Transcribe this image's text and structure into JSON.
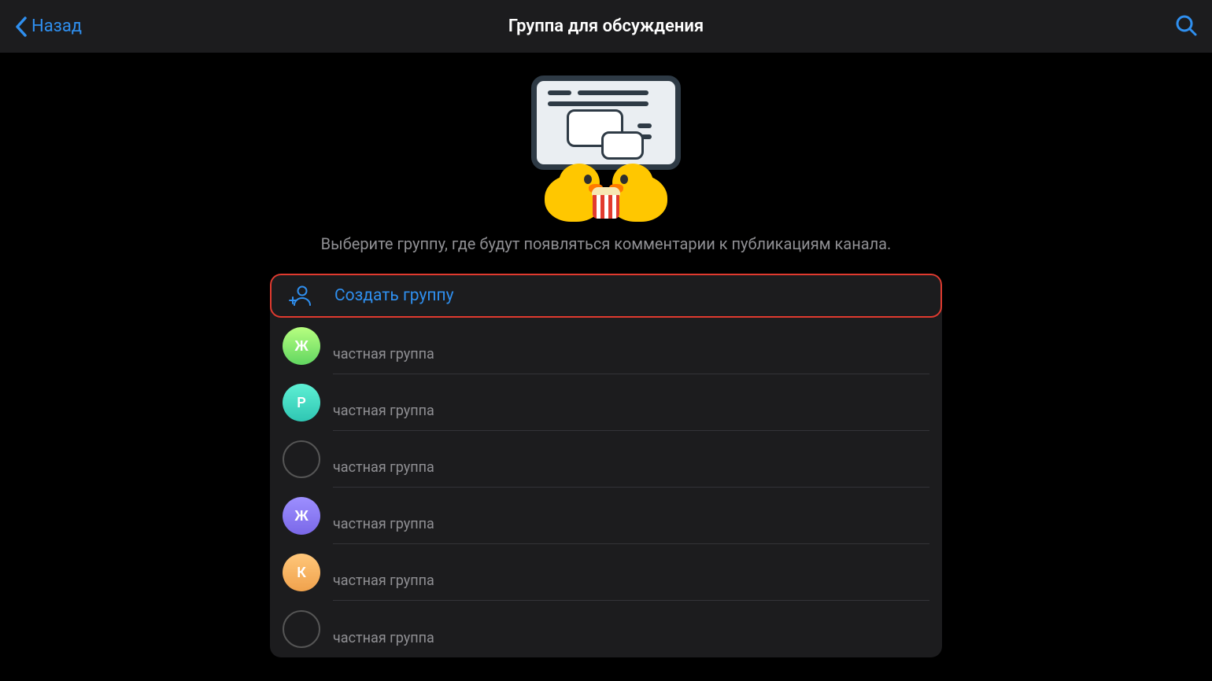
{
  "header": {
    "back_label": "Назад",
    "title": "Группа для обсуждения"
  },
  "description": "Выберите группу, где будут появляться комментарии к публикациям канала.",
  "create_label": "Создать группу",
  "groups": [
    {
      "initial": "Ж",
      "subtitle": "частная группа",
      "avatar_bg": "linear-gradient(180deg,#b7ff80,#62d661)",
      "avatar_type": "letter"
    },
    {
      "initial": "Р",
      "subtitle": "частная группа",
      "avatar_bg": "linear-gradient(180deg,#5ef0d4,#2fc6b3)",
      "avatar_type": "letter"
    },
    {
      "initial": "",
      "subtitle": "частная группа",
      "avatar_bg": "#1c1c1e",
      "avatar_type": "ring"
    },
    {
      "initial": "Ж",
      "subtitle": "частная группа",
      "avatar_bg": "linear-gradient(180deg,#9d8fff,#7a68e8)",
      "avatar_type": "letter"
    },
    {
      "initial": "К",
      "subtitle": "частная группа",
      "avatar_bg": "linear-gradient(180deg,#ffc77a,#f0a24d)",
      "avatar_type": "letter"
    },
    {
      "initial": "",
      "subtitle": "частная группа",
      "avatar_bg": "#1c1c1e",
      "avatar_type": "ring"
    }
  ],
  "colors": {
    "accent": "#2f8fef",
    "highlight_border": "#e03a2f"
  }
}
